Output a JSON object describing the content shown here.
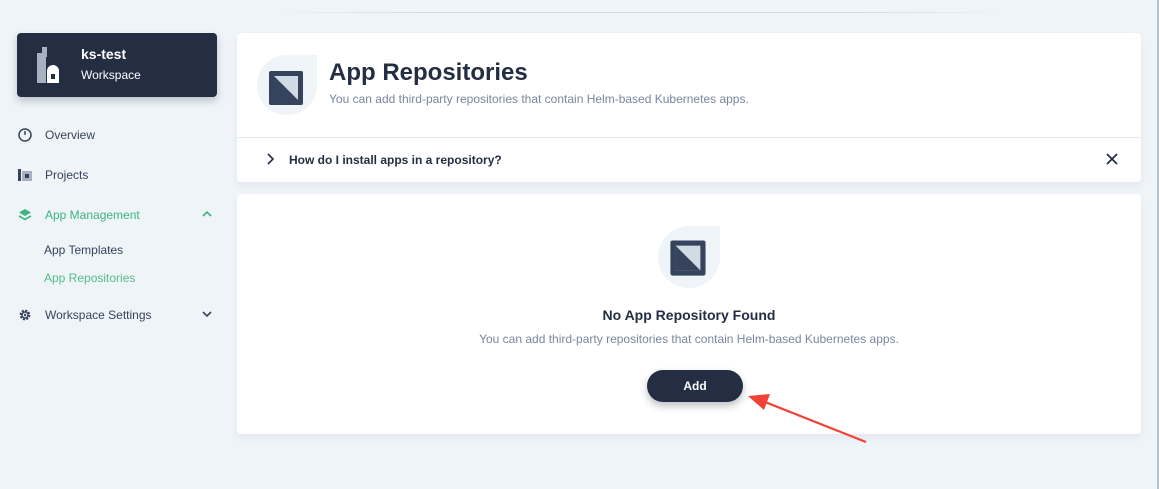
{
  "workspace": {
    "name": "ks-test",
    "type_label": "Workspace"
  },
  "sidebar": {
    "items": [
      {
        "label": "Overview",
        "icon": "dashboard-icon"
      },
      {
        "label": "Projects",
        "icon": "project-icon"
      },
      {
        "label": "App Management",
        "icon": "appcenter-icon",
        "expanded": true,
        "children": [
          {
            "label": "App Templates"
          },
          {
            "label": "App Repositories",
            "active": true
          }
        ]
      },
      {
        "label": "Workspace Settings",
        "icon": "cogwheel-icon",
        "expanded": false
      }
    ]
  },
  "header": {
    "title": "App Repositories",
    "description": "You can add third-party repositories that contain Helm-based Kubernetes apps.",
    "faq": "How do I install apps in a repository?"
  },
  "empty_state": {
    "title": "No App Repository Found",
    "description": "You can add third-party repositories that contain Helm-based Kubernetes apps.",
    "button_label": "Add"
  },
  "colors": {
    "accent_green": "#55bc8a",
    "dark": "#242e42",
    "annotation_arrow": "#f04134"
  }
}
